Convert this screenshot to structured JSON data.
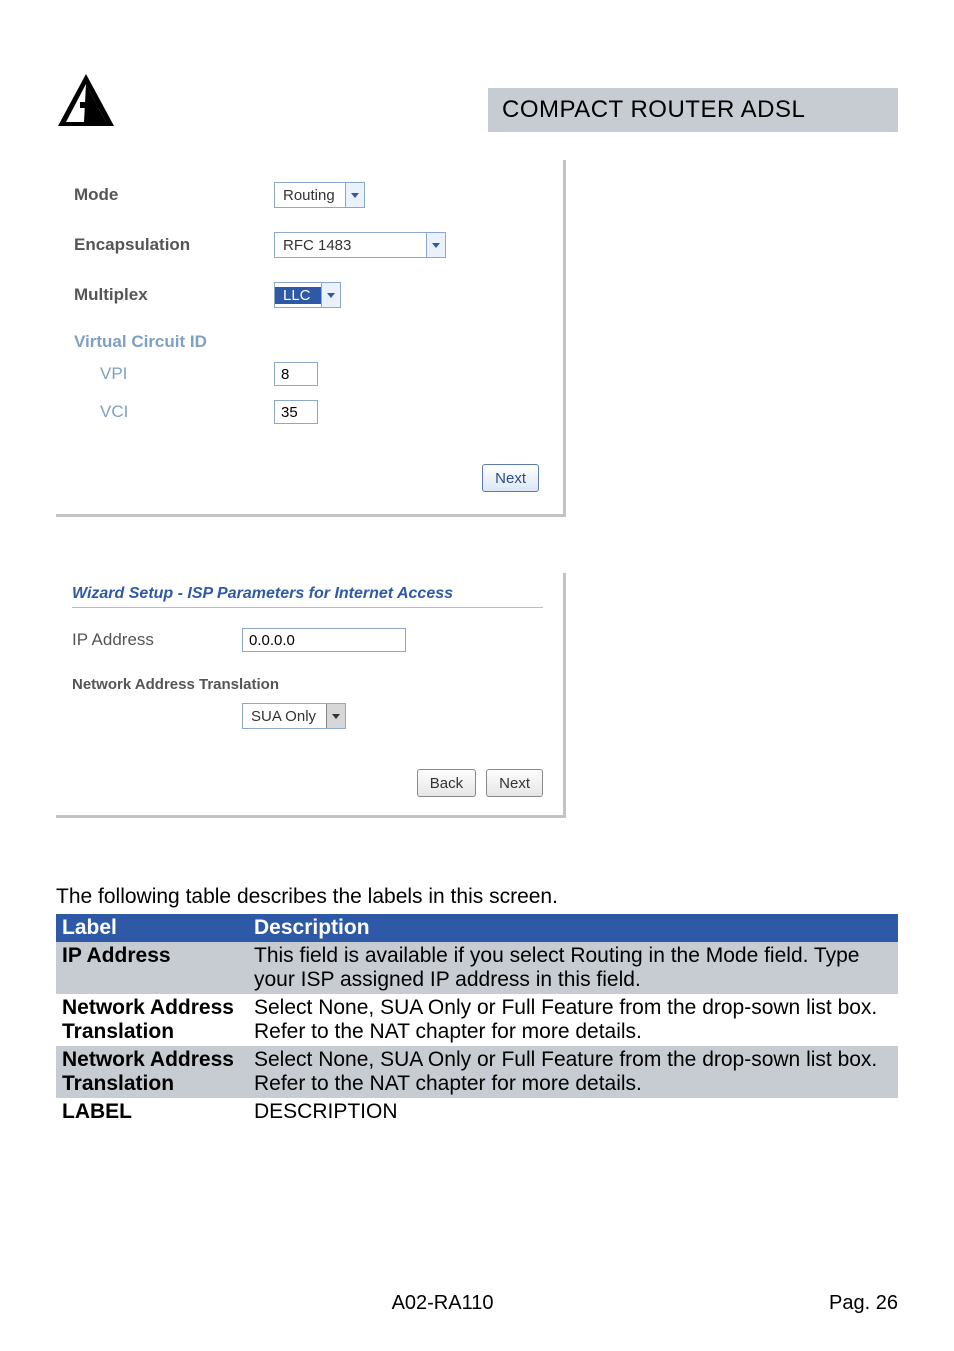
{
  "header": {
    "title": "COMPACT ROUTER ADSL"
  },
  "form": {
    "mode_label": "Mode",
    "mode_value": "Routing",
    "encap_label": "Encapsulation",
    "encap_value": "RFC 1483",
    "multiplex_label": "Multiplex",
    "multiplex_value": "LLC",
    "vcid_label": "Virtual Circuit ID",
    "vpi_label": "VPI",
    "vpi_value": "8",
    "vci_label": "VCI",
    "vci_value": "35",
    "next_label": "Next"
  },
  "wizard": {
    "title": "Wizard Setup - ISP Parameters for Internet Access",
    "ip_label": "IP Address",
    "ip_value": "0.0.0.0",
    "nat_label": "Network Address Translation",
    "nat_value": "SUA Only",
    "back_label": "Back",
    "next_label": "Next"
  },
  "caption": "The following table describes the labels in this screen.",
  "table": {
    "head_label": "Label",
    "head_desc": "Description",
    "rows": [
      {
        "cls": "gray",
        "label": "IP Address",
        "desc": "This field is available if you select Routing in the Mode field. Type your ISP assigned IP address in this field."
      },
      {
        "cls": "white",
        "label": "Network Address Translation",
        "desc": "Select None, SUA Only or Full Feature from the drop-sown list box. Refer to the NAT chapter for more details."
      },
      {
        "cls": "gray",
        "label": "Network Address Translation",
        "desc": "Select None, SUA Only or Full Feature from the drop-sown list box. Refer to the NAT chapter for more details."
      },
      {
        "cls": "white",
        "label": "LABEL",
        "desc": "DESCRIPTION"
      }
    ]
  },
  "footer": {
    "model": "A02-RA110",
    "page": "Pag. 26"
  }
}
